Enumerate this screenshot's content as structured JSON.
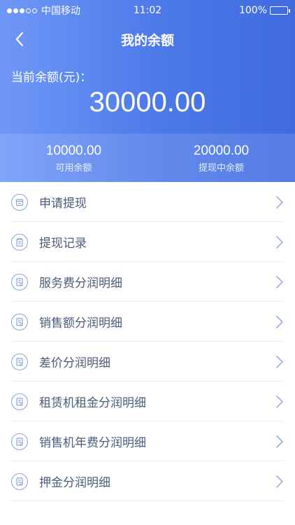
{
  "status_bar": {
    "carrier": "中国移动",
    "time": "11:02",
    "battery": "100%"
  },
  "nav": {
    "title": "我的余额",
    "back_icon": "chevron-left-icon"
  },
  "balance": {
    "label": "当前余额(元)：",
    "amount": "30000.00"
  },
  "summary": [
    {
      "value": "10000.00",
      "label": "可用余额"
    },
    {
      "value": "20000.00",
      "label": "提现中余额"
    }
  ],
  "menu": {
    "items": [
      {
        "label": "申请提现",
        "icon": "withdraw-card-icon"
      },
      {
        "label": "提现记录",
        "icon": "clipboard-icon"
      },
      {
        "label": "服务费分润明细",
        "icon": "document-icon"
      },
      {
        "label": "销售额分润明细",
        "icon": "document-icon"
      },
      {
        "label": "差价分润明细",
        "icon": "document-icon"
      },
      {
        "label": "租赁机租金分润明细",
        "icon": "document-icon"
      },
      {
        "label": "销售机年费分润明细",
        "icon": "document-icon"
      },
      {
        "label": "押金分润明细",
        "icon": "document-icon"
      }
    ]
  },
  "colors": {
    "header_start": "#6f98f7",
    "header_end": "#3f6bdf",
    "menu_text": "#4a5b7c",
    "icon_stroke": "#8aa4d8",
    "arrow": "#9db3df",
    "divider": "#e7ebf2"
  }
}
